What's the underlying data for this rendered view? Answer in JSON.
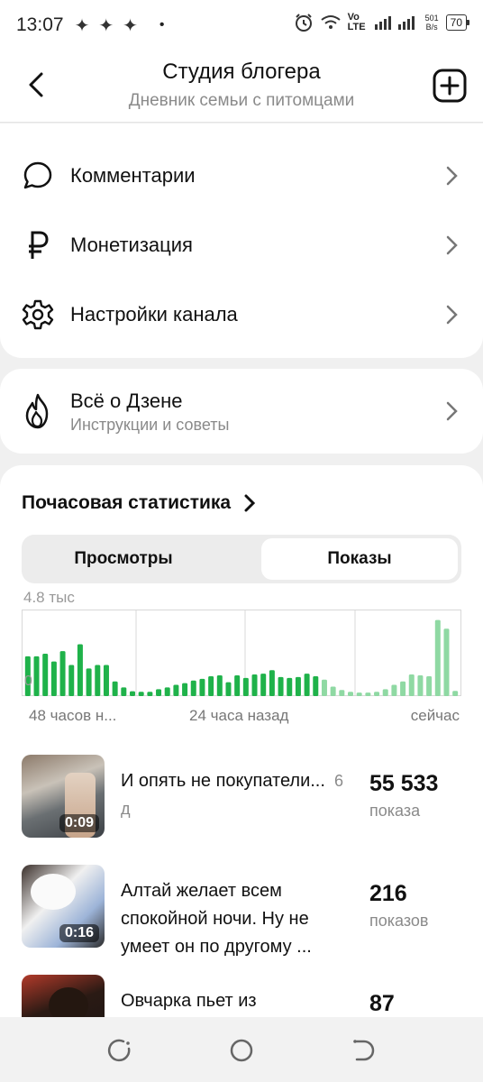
{
  "status_bar": {
    "time": "13:07",
    "sparks": "✦✦✦",
    "dot": "•",
    "net_speed_top": "501",
    "net_speed_bottom": "B/s",
    "network": "Vo LTE",
    "battery": "70"
  },
  "header": {
    "title": "Студия блогера",
    "subtitle": "Дневник семьи с питомцами"
  },
  "menu": {
    "items": [
      {
        "label": "Комментарии",
        "icon": "comment-icon"
      },
      {
        "label": "Монетизация",
        "icon": "ruble-icon"
      },
      {
        "label": "Настройки канала",
        "icon": "gear-icon"
      }
    ]
  },
  "zen": {
    "title": "Всё о Дзене",
    "subtitle": "Инструкции и советы",
    "icon": "flame-icon"
  },
  "stats": {
    "title": "Почасовая статистика",
    "tabs": [
      {
        "label": "Просмотры",
        "selected": false
      },
      {
        "label": "Показы",
        "selected": true
      }
    ],
    "y_max_label": "4.8 тыс",
    "y_min_label": "0",
    "x_labels": [
      "48 часов н...",
      "24 часа назад",
      "сейчас"
    ]
  },
  "chart_data": {
    "type": "bar",
    "ylim": [
      0,
      4800
    ],
    "colors": {
      "past": "#1fb24a",
      "recent": "#8fd9a3"
    },
    "recent_from_index": 34,
    "values": [
      2300,
      2300,
      2450,
      2000,
      2600,
      1800,
      3000,
      1600,
      1800,
      1800,
      850,
      500,
      280,
      250,
      250,
      400,
      500,
      650,
      750,
      900,
      1000,
      1150,
      1200,
      800,
      1200,
      1050,
      1250,
      1300,
      1500,
      1100,
      1050,
      1100,
      1300,
      1150,
      950,
      550,
      350,
      250,
      200,
      200,
      250,
      400,
      650,
      850,
      1250,
      1200,
      1150,
      4400,
      3900,
      300
    ]
  },
  "posts": [
    {
      "title": "И опять не покупатели...",
      "age": "6 д",
      "count": "55 533",
      "unit": "показа",
      "duration": "0:09"
    },
    {
      "title": "Алтай желает всем спокойной ночи. Ну не умеет он по другому ...",
      "age": "",
      "count": "216",
      "unit": "показов",
      "duration": "0:16"
    },
    {
      "title": "Овчарка пьет из",
      "age": "",
      "count": "87",
      "unit": "",
      "duration": ""
    }
  ]
}
